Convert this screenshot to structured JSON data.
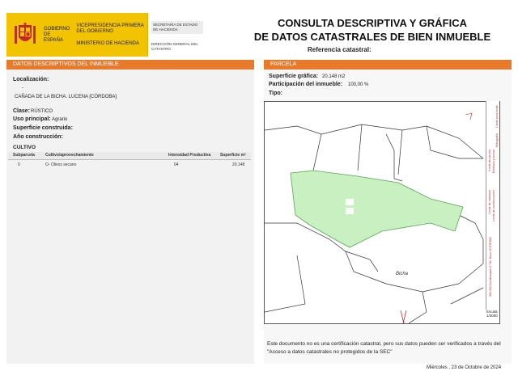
{
  "header": {
    "gov_left": "GOBIERNO DE ESPAÑA",
    "gov_vp": "VICEPRESIDENCIA PRIMERA DEL GOBIERNO",
    "gov_min": "MINISTERIO DE HACIENDA",
    "sec_top": "SECRETARÍA DE ESTADO DE HACIENDA",
    "sec_bottom": "DIRECCIÓN GENERAL DEL CATASTRO",
    "title_line1": "CONSULTA DESCRIPTIVA Y GRÁFICA",
    "title_line2": "DE DATOS CATASTRALES DE BIEN INMUEBLE",
    "ref_label": "Referencia catastral:",
    "brand_color": "#f2c300",
    "accent_color": "#e87a2c"
  },
  "left_panel": {
    "title": "DATOS DESCRIPTIVOS DEL INMUEBLE",
    "localizacion_label": "Localización:",
    "localizacion_dash": "-",
    "localizacion_value": "CAÑADA DE LA BICHA. LUCENA [CÓRDOBA]",
    "clase_label": "Clase:",
    "clase_value": "RÚSTICO",
    "uso_label": "Uso principal:",
    "uso_value": "Agrario",
    "superficie_label": "Superficie construida:",
    "anio_label": "Año construcción:",
    "cultivo": {
      "title": "CULTIVO",
      "headers": [
        "Subparcela",
        "Cultivo/aprovechamiento",
        "Intensidad Productiva",
        "Superficie m²"
      ],
      "rows": [
        [
          "0",
          "O- Olivos secano",
          "04",
          "20.148"
        ]
      ]
    }
  },
  "right_panel": {
    "title": "PARCELA",
    "sup_grafica_label": "Superficie gráfica:",
    "sup_grafica_value": "20.148 m2",
    "participacion_label": "Participación del inmueble:",
    "participacion_value": "100,00 %",
    "tipo_label": "Tipo:",
    "map_label": "Bicha",
    "legend": [
      "Límite de manzana",
      "Límite de parcela",
      "Límite de construcciones",
      "Mobiliario y aceras",
      "Límite zona verde",
      "Hidrografía"
    ],
    "coord_text": "366.300 Coordenadas U.T.M. Huso 30 ETRS89",
    "escala_label": "Escala:",
    "escala_value": "1/3000",
    "parcel_color": "#c9f0c0"
  },
  "footer": {
    "disclaimer": "Este documento no es una certificación catastral, pero sus datos pueden ser verificados a través del \"Acceso a datos catastrales no protegidos de la SEC\"",
    "date": "Miércoles , 23 de Octubre de 2024"
  }
}
